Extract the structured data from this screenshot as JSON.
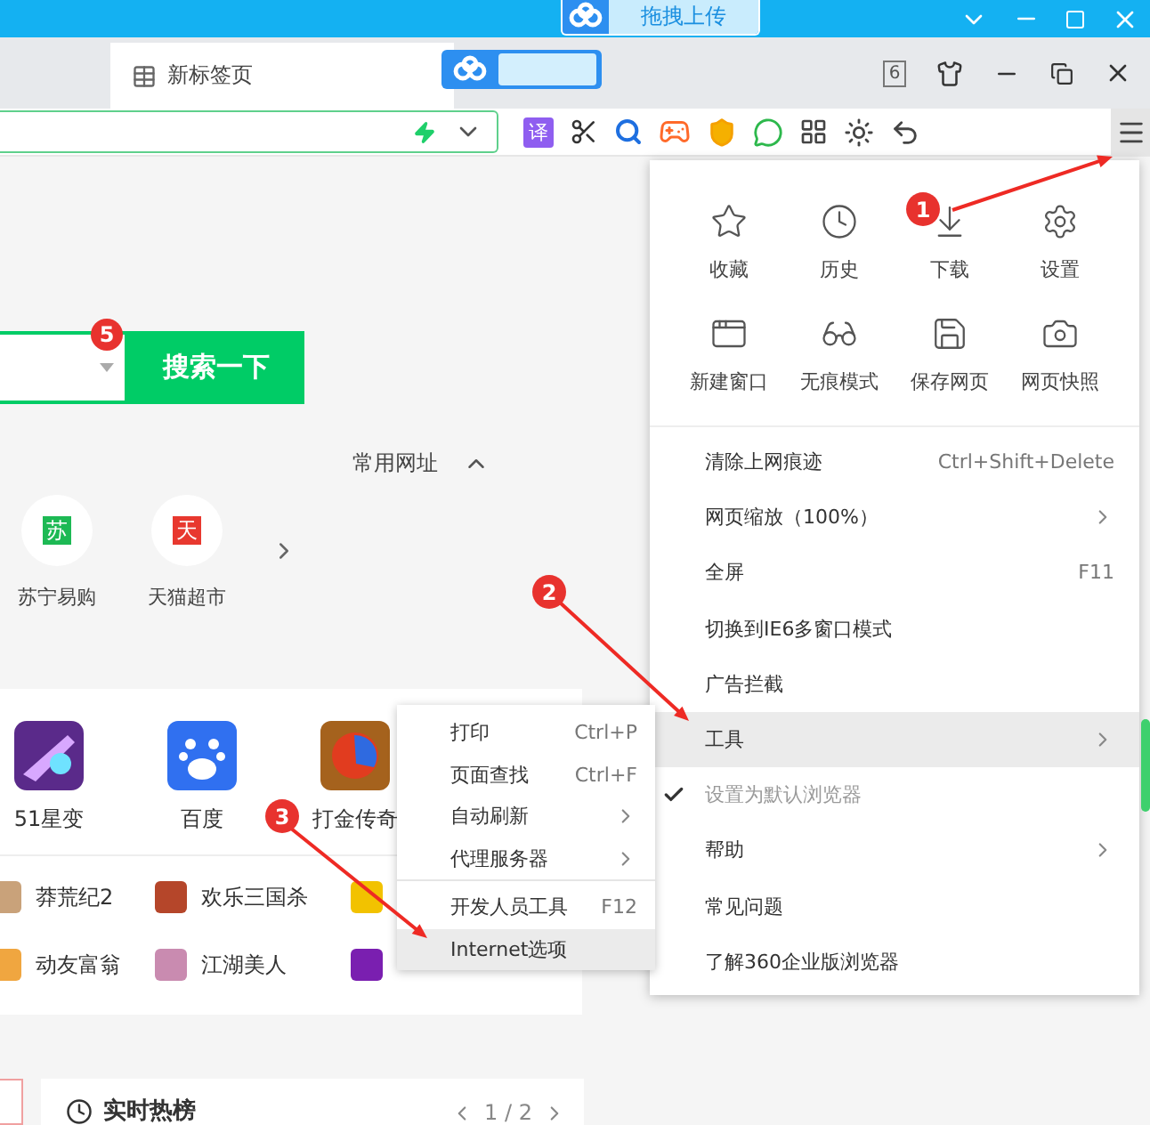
{
  "title_bar": {
    "upload_button": "拖拽上传"
  },
  "tabs": [
    {
      "label": "新标签页",
      "selected": true
    }
  ],
  "tab_bar": {
    "tab_count": "6"
  },
  "toolbar": {
    "translate_button": "译"
  },
  "search": {
    "button": "搜索一下",
    "badge": "5"
  },
  "common_sites": {
    "title": "常用网址",
    "expanded": true,
    "sites": [
      {
        "label": "苏宁易购",
        "glyph": "苏",
        "color": "#1db954"
      },
      {
        "label": "天猫超市",
        "glyph": "天",
        "color": "#e8382f"
      }
    ]
  },
  "apps": [
    {
      "label": "51星变",
      "kind": "game"
    },
    {
      "label": "百度",
      "kind": "paw"
    },
    {
      "label": "打金传奇",
      "kind": "orb"
    }
  ],
  "games": [
    {
      "label": "莽荒纪2",
      "color": "#c9a27a"
    },
    {
      "label": "欢乐三国杀",
      "color": "#b5462a"
    },
    {
      "color": "#f2c200"
    },
    {
      "label": "动友富翁",
      "color": "#f0a640"
    },
    {
      "label": "江湖美人",
      "color": "#c98bb0"
    },
    {
      "color": "#7a1fb0"
    }
  ],
  "hot_list": {
    "title": "实时热榜",
    "page": "1 / 2"
  },
  "main_menu": {
    "quick_actions": [
      {
        "label": "收藏",
        "kind": "star"
      },
      {
        "label": "历史",
        "kind": "clock"
      },
      {
        "label": "下载",
        "kind": "download"
      },
      {
        "label": "设置",
        "kind": "settings"
      },
      {
        "label": "新建窗口",
        "kind": "window"
      },
      {
        "label": "无痕模式",
        "kind": "incognito"
      },
      {
        "label": "保存网页",
        "kind": "save"
      },
      {
        "label": "网页快照",
        "kind": "camera"
      }
    ],
    "items": [
      {
        "label": "清除上网痕迹",
        "shortcut": "Ctrl+Shift+Delete",
        "submenu": false,
        "selected": false,
        "checked": false,
        "disabled": false
      },
      {
        "label": "网页缩放（100%）",
        "submenu": true,
        "selected": false,
        "checked": false,
        "disabled": false
      },
      {
        "label": "全屏",
        "shortcut": "F11",
        "submenu": false,
        "selected": false,
        "checked": false,
        "disabled": false
      },
      {
        "label": "切换到IE6多窗口模式",
        "submenu": false,
        "selected": false,
        "checked": false,
        "disabled": false
      },
      {
        "label": "广告拦截",
        "submenu": false,
        "selected": false,
        "checked": false,
        "disabled": false
      },
      {
        "label": "工具",
        "submenu": true,
        "selected": true,
        "checked": false,
        "disabled": false
      },
      {
        "label": "设置为默认浏览器",
        "submenu": false,
        "selected": false,
        "checked": true,
        "disabled": true
      },
      {
        "label": "帮助",
        "submenu": true,
        "selected": false,
        "checked": false,
        "disabled": false
      },
      {
        "label": "常见问题",
        "submenu": false,
        "selected": false,
        "checked": false,
        "disabled": false
      },
      {
        "label": "了解360企业版浏览器",
        "submenu": false,
        "selected": false,
        "checked": false,
        "disabled": false
      }
    ]
  },
  "tools_submenu": {
    "groups": [
      [
        {
          "label": "打印",
          "shortcut": "Ctrl+P",
          "submenu": false,
          "selected": false
        },
        {
          "label": "页面查找",
          "shortcut": "Ctrl+F",
          "submenu": false,
          "selected": false
        },
        {
          "label": "自动刷新",
          "submenu": true,
          "selected": false
        },
        {
          "label": "代理服务器",
          "submenu": true,
          "selected": false
        }
      ],
      [
        {
          "label": "开发人员工具",
          "shortcut": "F12",
          "submenu": false,
          "selected": false
        },
        {
          "label": "Internet选项",
          "submenu": false,
          "selected": true
        }
      ]
    ]
  },
  "annotations": [
    {
      "number": "1"
    },
    {
      "number": "2"
    },
    {
      "number": "3"
    }
  ]
}
